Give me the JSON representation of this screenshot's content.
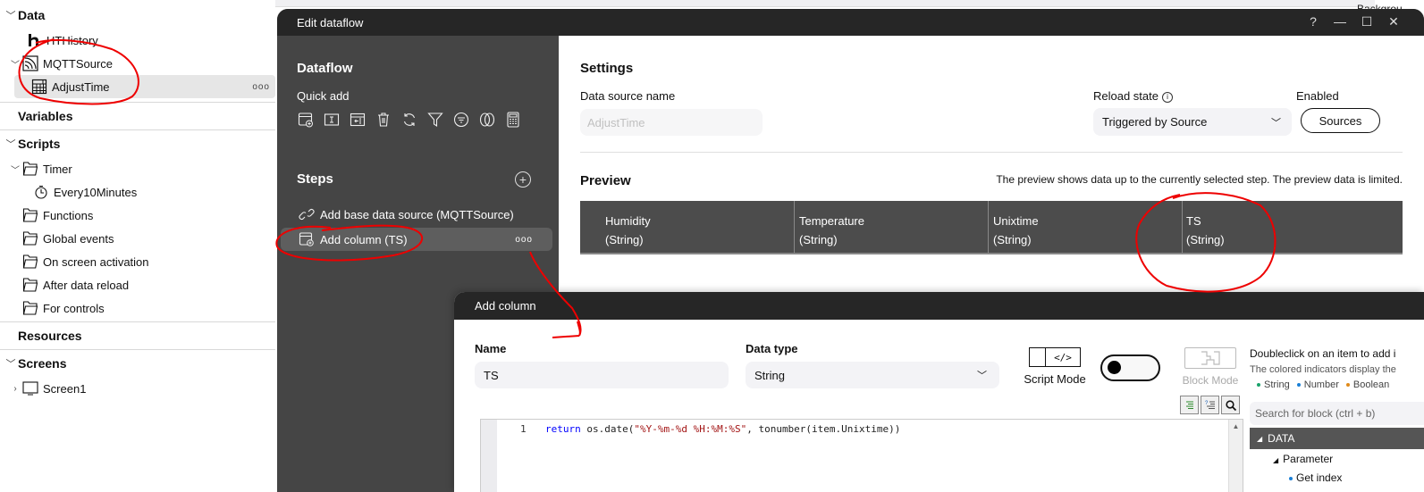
{
  "tree": {
    "sections": {
      "data": "Data",
      "variables": "Variables",
      "scripts": "Scripts",
      "resources": "Resources",
      "screens": "Screens"
    },
    "data_items": [
      {
        "label": "HTHistory",
        "icon": "history-h-icon"
      },
      {
        "label": "MQTTSource",
        "icon": "mqtt-signal-icon"
      },
      {
        "label": "AdjustTime",
        "icon": "table-icon",
        "selected": true,
        "more": "ooo"
      }
    ],
    "script_items": [
      {
        "label": "Timer",
        "icon": "folder-icon"
      },
      {
        "label": "Every10Minutes",
        "icon": "stopwatch-icon"
      },
      {
        "label": "Functions",
        "icon": "folder-icon"
      },
      {
        "label": "Global events",
        "icon": "folder-icon"
      },
      {
        "label": "On screen activation",
        "icon": "folder-icon"
      },
      {
        "label": "After data reload",
        "icon": "folder-icon"
      },
      {
        "label": "For controls",
        "icon": "folder-icon"
      }
    ],
    "screen_items": [
      {
        "label": "Screen1",
        "icon": "screen-icon"
      }
    ]
  },
  "background": {
    "right_label": "Backgrou"
  },
  "dataflow_window": {
    "title": "Edit dataflow",
    "controls": {
      "help": "?",
      "minimize": "—",
      "maximize": "☐",
      "close": "✕"
    },
    "left": {
      "heading": "Dataflow",
      "quick_add_label": "Quick add",
      "quick_add_icons": [
        "add-column-icon",
        "text-field-icon",
        "import-column-icon",
        "delete-icon",
        "refresh-icon",
        "filter-icon",
        "filter-circle-icon",
        "join-icon",
        "calculator-icon"
      ],
      "steps_heading": "Steps",
      "steps_add": "+",
      "steps": [
        {
          "label": "Add base data source (MQTTSource)",
          "icon": "link-icon"
        },
        {
          "label": "Add column (TS)",
          "icon": "add-column-icon",
          "selected": true,
          "more": "ooo"
        }
      ]
    },
    "settings": {
      "heading": "Settings",
      "ds_name_label": "Data source name",
      "ds_name_value": "AdjustTime",
      "enabled_label": "Enabled",
      "enabled": true,
      "reload_label": "Reload state",
      "reload_value": "Triggered by Source",
      "sources_button": "Sources"
    },
    "preview": {
      "heading": "Preview",
      "note": "The preview shows data up to the currently selected step. The preview data is limited.",
      "columns": [
        {
          "name": "Humidity",
          "type": "(String)"
        },
        {
          "name": "Temperature",
          "type": "(String)"
        },
        {
          "name": "Unixtime",
          "type": "(String)"
        },
        {
          "name": "TS",
          "type": "(String)"
        }
      ]
    }
  },
  "add_column_dialog": {
    "title": "Add column",
    "name_label": "Name",
    "name_value": "TS",
    "type_label": "Data type",
    "type_value": "String",
    "script_mode_label": "Script Mode",
    "script_mode_glyph": "</>",
    "block_mode_label": "Block Mode",
    "editor": {
      "line_number": "1",
      "code_keyword": "return",
      "code_pre": " os.date(",
      "code_string": "\"%Y-%m-%d %H:%M:%S\"",
      "code_post": ", tonumber(item.Unixtime))"
    },
    "help_line1": "Doubleclick on an item to add i",
    "help_line2": "The colored indicators display the",
    "type_legend": [
      {
        "label": "String",
        "color": "#1aa36b"
      },
      {
        "label": "Number",
        "color": "#1a7fd6"
      },
      {
        "label": "Boolean",
        "color": "#e08a1a"
      }
    ],
    "block_search_placeholder": "Search for block (ctrl + b)",
    "block_tree": {
      "head": "DATA",
      "items": [
        {
          "label": "Parameter"
        },
        {
          "label": "Get index",
          "color": "#1a7fd6"
        }
      ]
    }
  }
}
